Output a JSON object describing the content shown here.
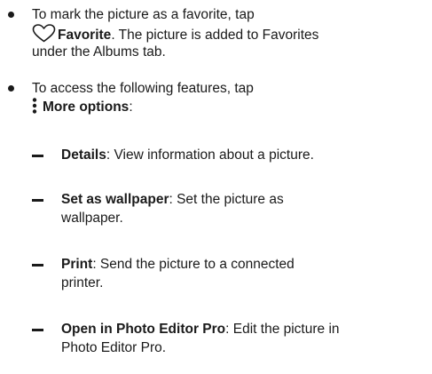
{
  "bullets": [
    {
      "line1": "To mark the picture as a favorite, tap",
      "action_label": "Favorite",
      "after_action": ". The picture is added to Favorites",
      "line3": "under the Albums tab.",
      "icon": "heart-outline-icon"
    },
    {
      "line1": "To access the following features, tap",
      "action_label": "More options",
      "after_action": ":",
      "icon": "more-options-vertical-dots-icon"
    }
  ],
  "sub_items": [
    {
      "term": "Details",
      "desc_line1": ": View information about a picture.",
      "desc_line2": ""
    },
    {
      "term": "Set as wallpaper",
      "desc_line1": ": Set the picture as",
      "desc_line2": "wallpaper."
    },
    {
      "term": "Print",
      "desc_line1": ": Send the picture to a connected",
      "desc_line2": "printer."
    },
    {
      "term": "Open in Photo Editor Pro",
      "desc_line1": ": Edit the picture in",
      "desc_line2": "Photo Editor Pro."
    }
  ],
  "colors": {
    "text": "#1a1a1a",
    "icon": "#1a1a1a"
  }
}
